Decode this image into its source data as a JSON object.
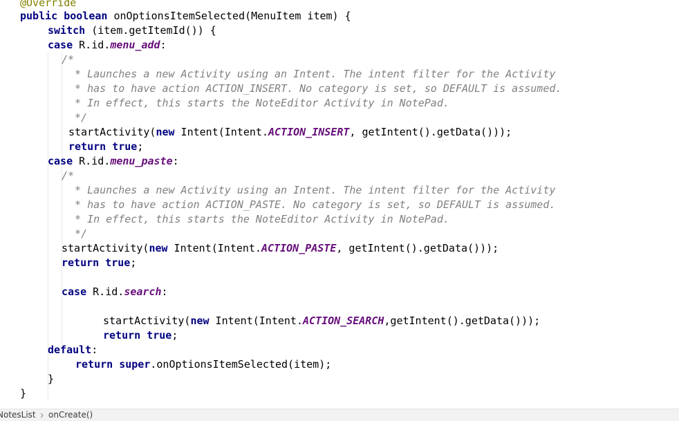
{
  "editor": {
    "language": "java",
    "lines": [
      {
        "tokens": [
          {
            "t": "@Override",
            "c": "ann"
          }
        ]
      },
      {
        "tokens": [
          {
            "t": "public",
            "c": "kw"
          },
          {
            "t": " "
          },
          {
            "t": "boolean",
            "c": "kw"
          },
          {
            "t": " onOptionsItemSelected(MenuItem item) {"
          }
        ]
      },
      {
        "tokens": [
          {
            "t": "switch",
            "c": "kw"
          },
          {
            "t": " (item.getItemId()) {"
          }
        ]
      },
      {
        "tokens": [
          {
            "t": "case",
            "c": "kw"
          },
          {
            "t": " R.id."
          },
          {
            "t": "menu_add",
            "c": "fld"
          },
          {
            "t": ":"
          }
        ]
      },
      {
        "tokens": [
          {
            "t": "/*",
            "c": "cm"
          }
        ]
      },
      {
        "tokens": [
          {
            "t": " * Launches a new Activity using an Intent. The intent filter for the Activity",
            "c": "cm"
          }
        ]
      },
      {
        "tokens": [
          {
            "t": " * has to have action ACTION_INSERT. No category is set, so DEFAULT is assumed.",
            "c": "cm"
          }
        ]
      },
      {
        "tokens": [
          {
            "t": " * In effect, this starts the NoteEditor Activity in NotePad.",
            "c": "cm"
          }
        ]
      },
      {
        "tokens": [
          {
            "t": " */",
            "c": "cm"
          }
        ]
      },
      {
        "tokens": [
          {
            "t": "startActivity("
          },
          {
            "t": "new",
            "c": "kw"
          },
          {
            "t": " Intent(Intent."
          },
          {
            "t": "ACTION_INSERT",
            "c": "fld"
          },
          {
            "t": ", getIntent().getData()));"
          }
        ]
      },
      {
        "tokens": [
          {
            "t": "return",
            "c": "kw"
          },
          {
            "t": " "
          },
          {
            "t": "true",
            "c": "kw"
          },
          {
            "t": ";"
          }
        ]
      },
      {
        "tokens": [
          {
            "t": "case",
            "c": "kw"
          },
          {
            "t": " R.id."
          },
          {
            "t": "menu_paste",
            "c": "fld"
          },
          {
            "t": ":"
          }
        ]
      },
      {
        "tokens": [
          {
            "t": "/*",
            "c": "cm"
          }
        ]
      },
      {
        "tokens": [
          {
            "t": " * Launches a new Activity using an Intent. The intent filter for the Activity",
            "c": "cm"
          }
        ]
      },
      {
        "tokens": [
          {
            "t": " * has to have action ACTION_PASTE. No category is set, so DEFAULT is assumed.",
            "c": "cm"
          }
        ]
      },
      {
        "tokens": [
          {
            "t": " * In effect, this starts the NoteEditor Activity in NotePad.",
            "c": "cm"
          }
        ]
      },
      {
        "tokens": [
          {
            "t": " */",
            "c": "cm"
          }
        ]
      },
      {
        "tokens": [
          {
            "t": "startActivity("
          },
          {
            "t": "new",
            "c": "kw"
          },
          {
            "t": " Intent(Intent."
          },
          {
            "t": "ACTION_PASTE",
            "c": "fld"
          },
          {
            "t": ", getIntent().getData()));"
          }
        ]
      },
      {
        "tokens": [
          {
            "t": "return",
            "c": "kw"
          },
          {
            "t": " "
          },
          {
            "t": "true",
            "c": "kw"
          },
          {
            "t": ";"
          }
        ]
      },
      {
        "tokens": []
      },
      {
        "tokens": [
          {
            "t": "case",
            "c": "kw"
          },
          {
            "t": " R.id."
          },
          {
            "t": "search",
            "c": "fld"
          },
          {
            "t": ":"
          }
        ]
      },
      {
        "tokens": []
      },
      {
        "tokens": [
          {
            "t": "startActivity("
          },
          {
            "t": "new",
            "c": "kw"
          },
          {
            "t": " Intent(Intent."
          },
          {
            "t": "ACTION_SEARCH",
            "c": "fld"
          },
          {
            "t": ",getIntent().getData()));"
          }
        ]
      },
      {
        "tokens": [
          {
            "t": "return",
            "c": "kw"
          },
          {
            "t": " "
          },
          {
            "t": "true",
            "c": "kw"
          },
          {
            "t": ";"
          }
        ]
      },
      {
        "tokens": [
          {
            "t": "default",
            "c": "kw"
          },
          {
            "t": ":"
          }
        ]
      },
      {
        "tokens": [
          {
            "t": "return",
            "c": "kw"
          },
          {
            "t": " "
          },
          {
            "t": "super",
            "c": "kw"
          },
          {
            "t": ".onOptionsItemSelected(item);"
          }
        ]
      },
      {
        "tokens": [
          {
            "t": "}"
          }
        ]
      },
      {
        "tokens": [
          {
            "t": "}"
          }
        ]
      }
    ]
  },
  "breadcrumb": {
    "items": [
      "NotesList",
      "onCreate()"
    ]
  }
}
